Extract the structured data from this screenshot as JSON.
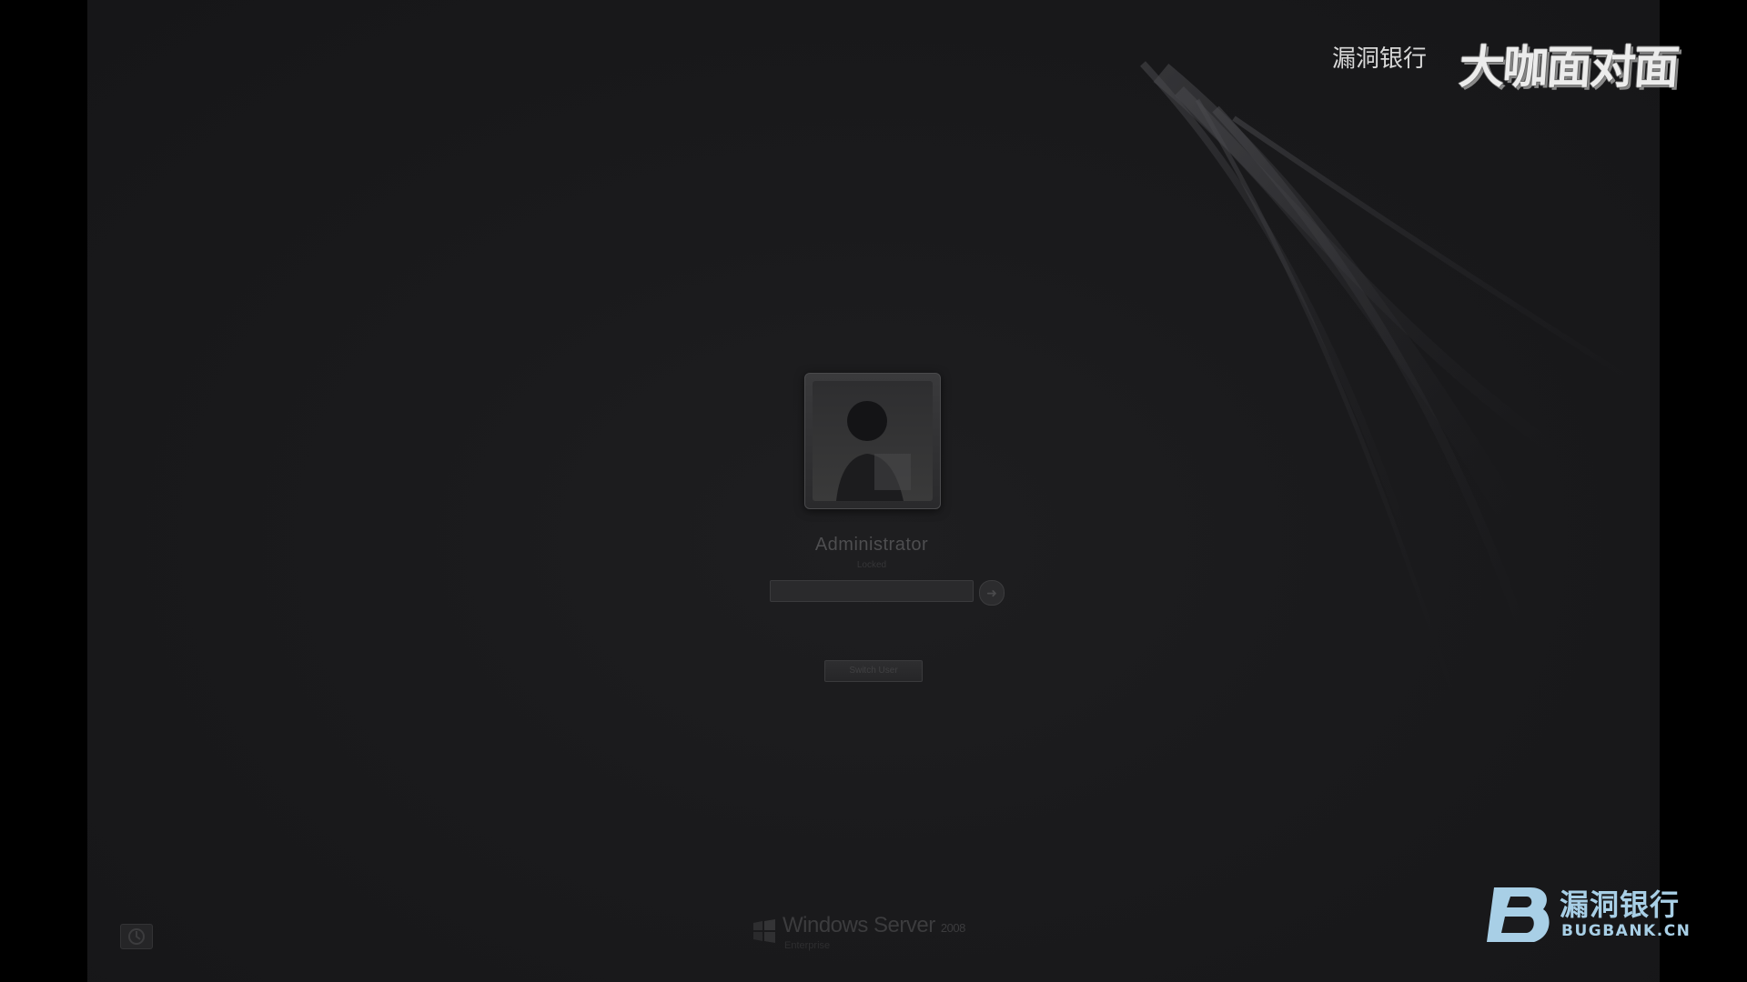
{
  "login": {
    "username": "Administrator",
    "status": "Locked",
    "password_value": "",
    "password_placeholder": "",
    "switch_user_label": "Switch User"
  },
  "branding": {
    "product": "Windows Server",
    "edition_suffix": "2008",
    "edition": "Enterprise"
  },
  "watermark": {
    "top_text": "漏洞银行",
    "top_logo": "大咖面对面",
    "bottom_cn": "漏洞银行",
    "bottom_en": "BUGBANK.CN"
  },
  "icons": {
    "user_picture": "user-silhouette-icon",
    "submit": "right-arrow-icon",
    "ease_of_access": "ease-of-access-icon",
    "windows_logo": "windows-flag-icon",
    "bugbank_logo": "b-logo-icon"
  },
  "colors": {
    "background": "#1a1a1c",
    "letterbox": "#000000",
    "watermark_blue": "#a8cfe6"
  }
}
